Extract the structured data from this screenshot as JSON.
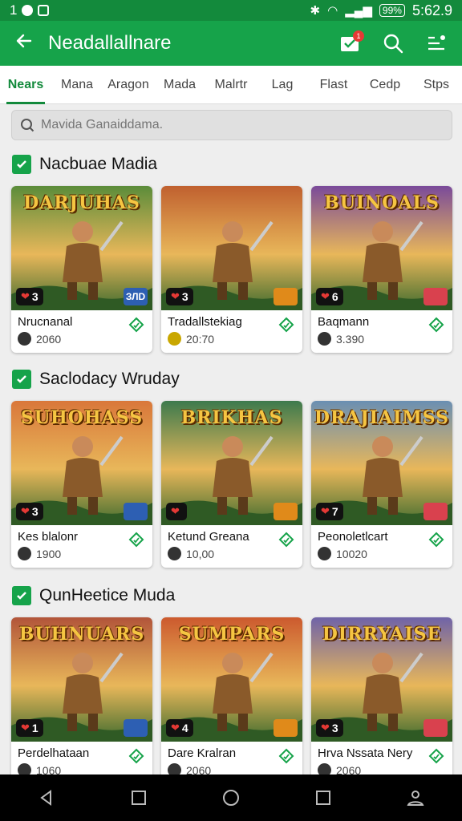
{
  "status": {
    "left": "1",
    "time": "5:62.9",
    "battery": "99%"
  },
  "appbar": {
    "title": "Neadallallnare"
  },
  "tabs": [
    "Nears",
    "Mana",
    "Aragon",
    "Mada",
    "Malrtr",
    "Lag",
    "Flast",
    "Cedp",
    "Stps"
  ],
  "search": {
    "placeholder": "Mavida Ganaiddama."
  },
  "sections": [
    {
      "title": "Nacbuae Madia",
      "cards": [
        {
          "art_title": "DARJUHAS",
          "likes": "3",
          "tag": "ЗЛD",
          "name": "Nrucnanal",
          "count": "2060"
        },
        {
          "art_title": "",
          "likes": "3",
          "tag": "",
          "name": "Tradallstekiag",
          "count": "20:70"
        },
        {
          "art_title": "BUINOALS",
          "likes": "6",
          "tag": "",
          "name": "Baqmann",
          "count": "3.390"
        }
      ]
    },
    {
      "title": "Saclodacy Wruday",
      "cards": [
        {
          "art_title": "SUHOHASS",
          "likes": "3",
          "tag": "",
          "name": "Kes blalonr",
          "count": "1900"
        },
        {
          "art_title": "BRIKHAS",
          "likes": "",
          "tag": "",
          "name": "Ketund Greana",
          "count": "10,00"
        },
        {
          "art_title": "DRAJIAIMSS",
          "likes": "7",
          "tag": "",
          "name": "Peonoletlcart",
          "count": "10020"
        }
      ]
    },
    {
      "title": "QunHeetice Muda",
      "cards": [
        {
          "art_title": "BUHNUARS",
          "likes": "1",
          "tag": "",
          "name": "Perdelhataan",
          "count": "1060"
        },
        {
          "art_title": "SUMPARS",
          "likes": "4",
          "tag": "",
          "name": "Dare Kralran",
          "count": "2060"
        },
        {
          "art_title": "DIRRYAISE",
          "likes": "3",
          "tag": "",
          "name": "Hrva Nssata Nery",
          "count": "2060"
        }
      ]
    }
  ],
  "colors": {
    "primary": "#16a34a",
    "statusbar": "#138a3c"
  }
}
